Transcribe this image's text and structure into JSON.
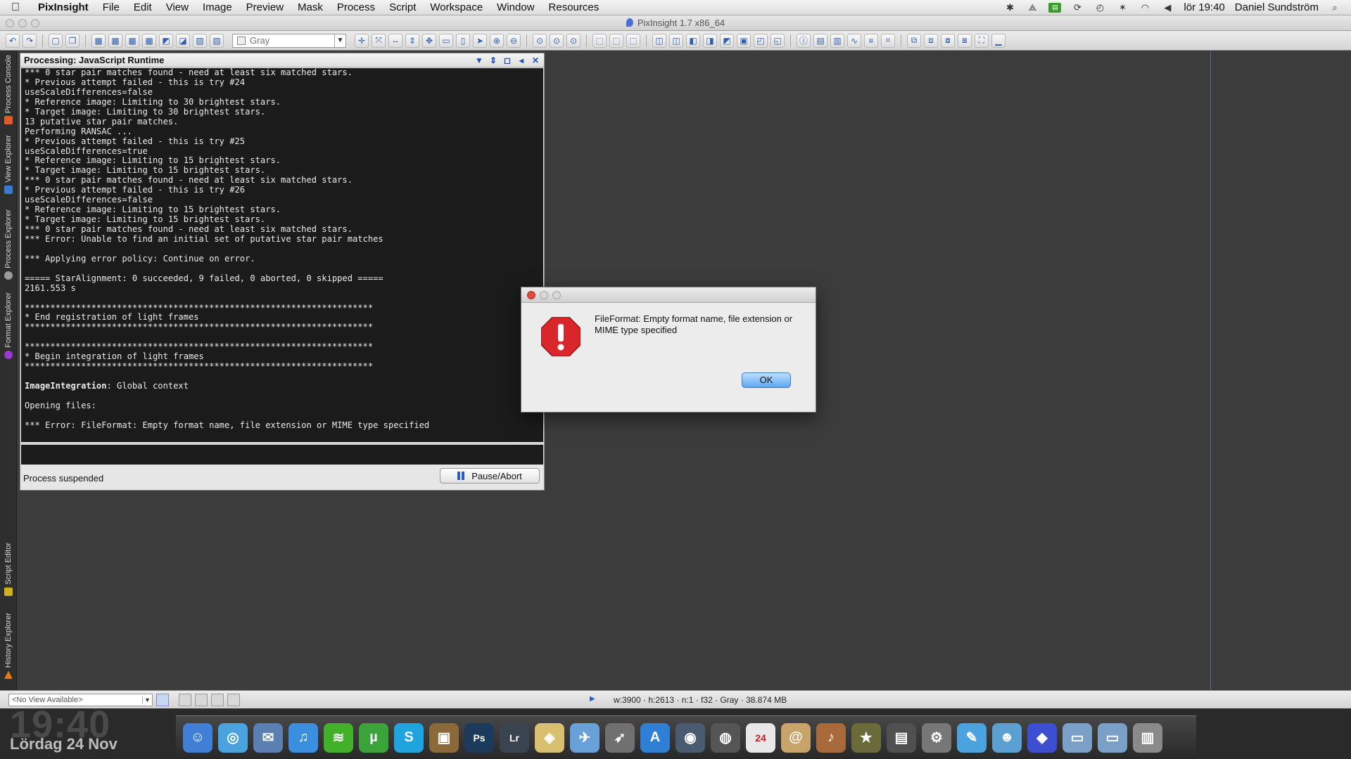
{
  "menubar": {
    "app": "PixInsight",
    "items": [
      "File",
      "Edit",
      "View",
      "Image",
      "Preview",
      "Mask",
      "Process",
      "Script",
      "Workspace",
      "Window",
      "Resources"
    ],
    "clock": "lör 19:40",
    "user": "Daniel Sundström"
  },
  "window": {
    "title": "PixInsight 1.7 x86_64"
  },
  "toolbar": {
    "color_space": "Gray"
  },
  "sidetabs": [
    "Process Console",
    "View Explorer",
    "Process Explorer",
    "Format Explorer",
    "Script Editor",
    "History Explorer"
  ],
  "console": {
    "title": "Processing: JavaScript Runtime",
    "lines": [
      "*** 0 star pair matches found - need at least six matched stars.",
      "* Previous attempt failed - this is try #24",
      "useScaleDifferences=false",
      "* Reference image: Limiting to 30 brightest stars.",
      "* Target image: Limiting to 30 brightest stars.",
      "13 putative star pair matches.",
      "Performing RANSAC ...",
      "* Previous attempt failed - this is try #25",
      "useScaleDifferences=true",
      "* Reference image: Limiting to 15 brightest stars.",
      "* Target image: Limiting to 15 brightest stars.",
      "*** 0 star pair matches found - need at least six matched stars.",
      "* Previous attempt failed - this is try #26",
      "useScaleDifferences=false",
      "* Reference image: Limiting to 15 brightest stars.",
      "* Target image: Limiting to 15 brightest stars.",
      "*** 0 star pair matches found - need at least six matched stars.",
      "*** Error: Unable to find an initial set of putative star pair matches",
      "",
      "*** Applying error policy: Continue on error.",
      "",
      "===== StarAlignment: 0 succeeded, 9 failed, 0 aborted, 0 skipped =====",
      "2161.553 s",
      "",
      "********************************************************************",
      "* End registration of light frames",
      "********************************************************************",
      "",
      "********************************************************************",
      "* Begin integration of light frames",
      "********************************************************************",
      "",
      "ImageIntegration: Global context",
      "",
      "Opening files:",
      "",
      "*** Error: FileFormat: Empty format name, file extension or MIME type specified"
    ],
    "status": "Process suspended",
    "pause_label": "Pause/Abort"
  },
  "dialog": {
    "message": "FileFormat: Empty format name, file extension or MIME type specified",
    "ok_label": "OK"
  },
  "statusbar": {
    "view_selector": "<No View Available>",
    "image_info": "w:3900 · h:2613 · n:1 · f32 · Gray · 38.874 MB"
  },
  "desktop": {
    "clock": "19:40",
    "date": "Lördag 24 Nov"
  },
  "dock": {
    "items": [
      {
        "name": "finder-icon",
        "glyph": "☺",
        "color": "#3f7fd6"
      },
      {
        "name": "safari-icon",
        "glyph": "◎",
        "color": "#4aa3df"
      },
      {
        "name": "mail-icon",
        "glyph": "✉",
        "color": "#5b7fb0"
      },
      {
        "name": "itunes-icon",
        "glyph": "♫",
        "color": "#3a8fe0"
      },
      {
        "name": "spotify-icon",
        "glyph": "≋",
        "color": "#43b02a"
      },
      {
        "name": "utorrent-icon",
        "glyph": "µ",
        "color": "#3aa33a"
      },
      {
        "name": "skype-icon",
        "glyph": "S",
        "color": "#1fa4e0"
      },
      {
        "name": "iphoto-icon",
        "glyph": "▣",
        "color": "#8a6a3a"
      },
      {
        "name": "photoshop-icon",
        "glyph": "Ps",
        "color": "#1b3a5c"
      },
      {
        "name": "lightroom-icon",
        "glyph": "Lr",
        "color": "#3a4450"
      },
      {
        "name": "maps-icon",
        "glyph": "◈",
        "color": "#d8c070"
      },
      {
        "name": "mail-bird-icon",
        "glyph": "✈",
        "color": "#6aa0d8"
      },
      {
        "name": "rocket-icon",
        "glyph": "➶",
        "color": "#707070"
      },
      {
        "name": "appstore-icon",
        "glyph": "A",
        "color": "#2f7fd6"
      },
      {
        "name": "camera-icon",
        "glyph": "◉",
        "color": "#4a5a70"
      },
      {
        "name": "speaker-icon",
        "glyph": "◍",
        "color": "#555555"
      },
      {
        "name": "calendar-icon",
        "glyph": "24",
        "color": "#e8e8e8"
      },
      {
        "name": "contacts-icon",
        "glyph": "@",
        "color": "#c9a46a"
      },
      {
        "name": "guitar-icon",
        "glyph": "♪",
        "color": "#a86a3a"
      },
      {
        "name": "star-icon",
        "glyph": "★",
        "color": "#6a6a3a"
      },
      {
        "name": "dashboard-icon",
        "glyph": "▤",
        "color": "#505050"
      },
      {
        "name": "settings-icon",
        "glyph": "⚙",
        "color": "#777777"
      },
      {
        "name": "messages-icon",
        "glyph": "✎",
        "color": "#4aa3df"
      },
      {
        "name": "users-icon",
        "glyph": "☻",
        "color": "#5aa0d0"
      },
      {
        "name": "pixinsight-icon",
        "glyph": "◆",
        "color": "#3b4fd0"
      },
      {
        "name": "folder-icon",
        "glyph": "▭",
        "color": "#7aa0c8"
      },
      {
        "name": "downloads-icon",
        "glyph": "▭",
        "color": "#7aa0c8"
      },
      {
        "name": "trash-icon",
        "glyph": "▥",
        "color": "#8a8a8a"
      }
    ]
  },
  "colors": {
    "workspace": "#3c3c3c",
    "console_bg": "#1b1b1b",
    "error_red": "#d8262b",
    "ok_button": "#5aa7f2"
  }
}
